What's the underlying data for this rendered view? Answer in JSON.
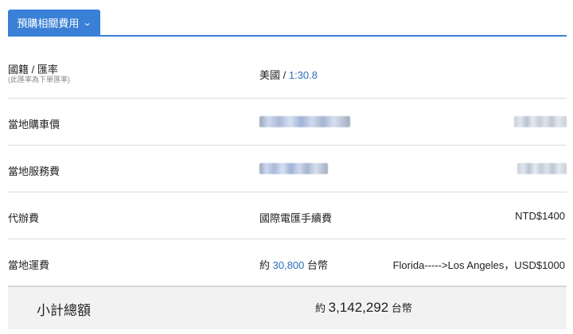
{
  "tab": {
    "label": "預購相關費用",
    "chevron": "⌄"
  },
  "rows": {
    "nationality": {
      "label": "國籍 / 匯率",
      "note": "(此匯率為下單匯率)",
      "country": "美國",
      "sep": " / ",
      "rate": "1:30.8"
    },
    "car_price": {
      "label": "當地購車價"
    },
    "service_fee": {
      "label": "當地服務費"
    },
    "agency_fee": {
      "label": "代辦費",
      "desc": "國際電匯手續費",
      "amount": "NTD$1400"
    },
    "shipping": {
      "label": "當地運費",
      "prefix": "約 ",
      "value": "30,800",
      "unit": " 台幣",
      "route": "Florida----->Los Angeles，USD$1000"
    }
  },
  "subtotal": {
    "label": "小計總額",
    "prefix": "約 ",
    "value": "3,142,292",
    "unit": " 台幣"
  },
  "colors": {
    "accent": "#3a80d6",
    "link_blue": "#2f6fb6",
    "total_bg": "#f2f2f2"
  }
}
